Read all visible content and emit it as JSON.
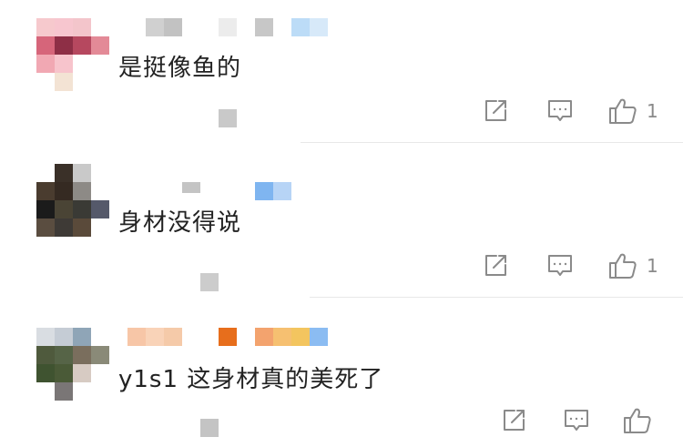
{
  "comments": [
    {
      "text": "是挺像鱼的",
      "like_count": "1",
      "share_icon": "share-icon",
      "reply_icon": "comment-icon",
      "like_icon": "thumb-up-icon"
    },
    {
      "text": "身材没得说",
      "like_count": "1",
      "share_icon": "share-icon",
      "reply_icon": "comment-icon",
      "like_icon": "thumb-up-icon"
    },
    {
      "text": "y1s1 这身材真的美死了",
      "like_count": "",
      "share_icon": "share-icon",
      "reply_icon": "comment-icon",
      "like_icon": "thumb-up-icon"
    }
  ],
  "colors": {
    "text": "#222222",
    "icon": "#8a8a8a",
    "divider": "#e8e8e8"
  }
}
